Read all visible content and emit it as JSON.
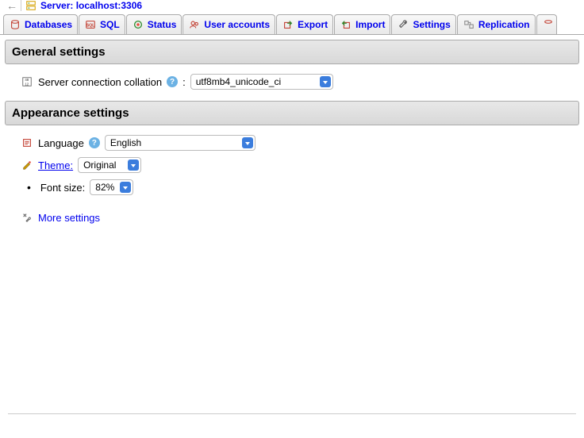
{
  "server": {
    "label": "Server: localhost:3306"
  },
  "tabs": {
    "databases": "Databases",
    "sql": "SQL",
    "status": "Status",
    "user_accounts": "User accounts",
    "export": "Export",
    "import": "Import",
    "settings": "Settings",
    "replication": "Replication"
  },
  "sections": {
    "general_settings": "General settings",
    "appearance_settings": "Appearance settings"
  },
  "general": {
    "collation_label": "Server connection collation",
    "collation_value": "utf8mb4_unicode_ci"
  },
  "appearance": {
    "language_label": "Language",
    "language_value": "English",
    "theme_label": "Theme:",
    "theme_value": "Original",
    "fontsize_label": "Font size:",
    "fontsize_value": "82%",
    "more_settings": "More settings"
  }
}
